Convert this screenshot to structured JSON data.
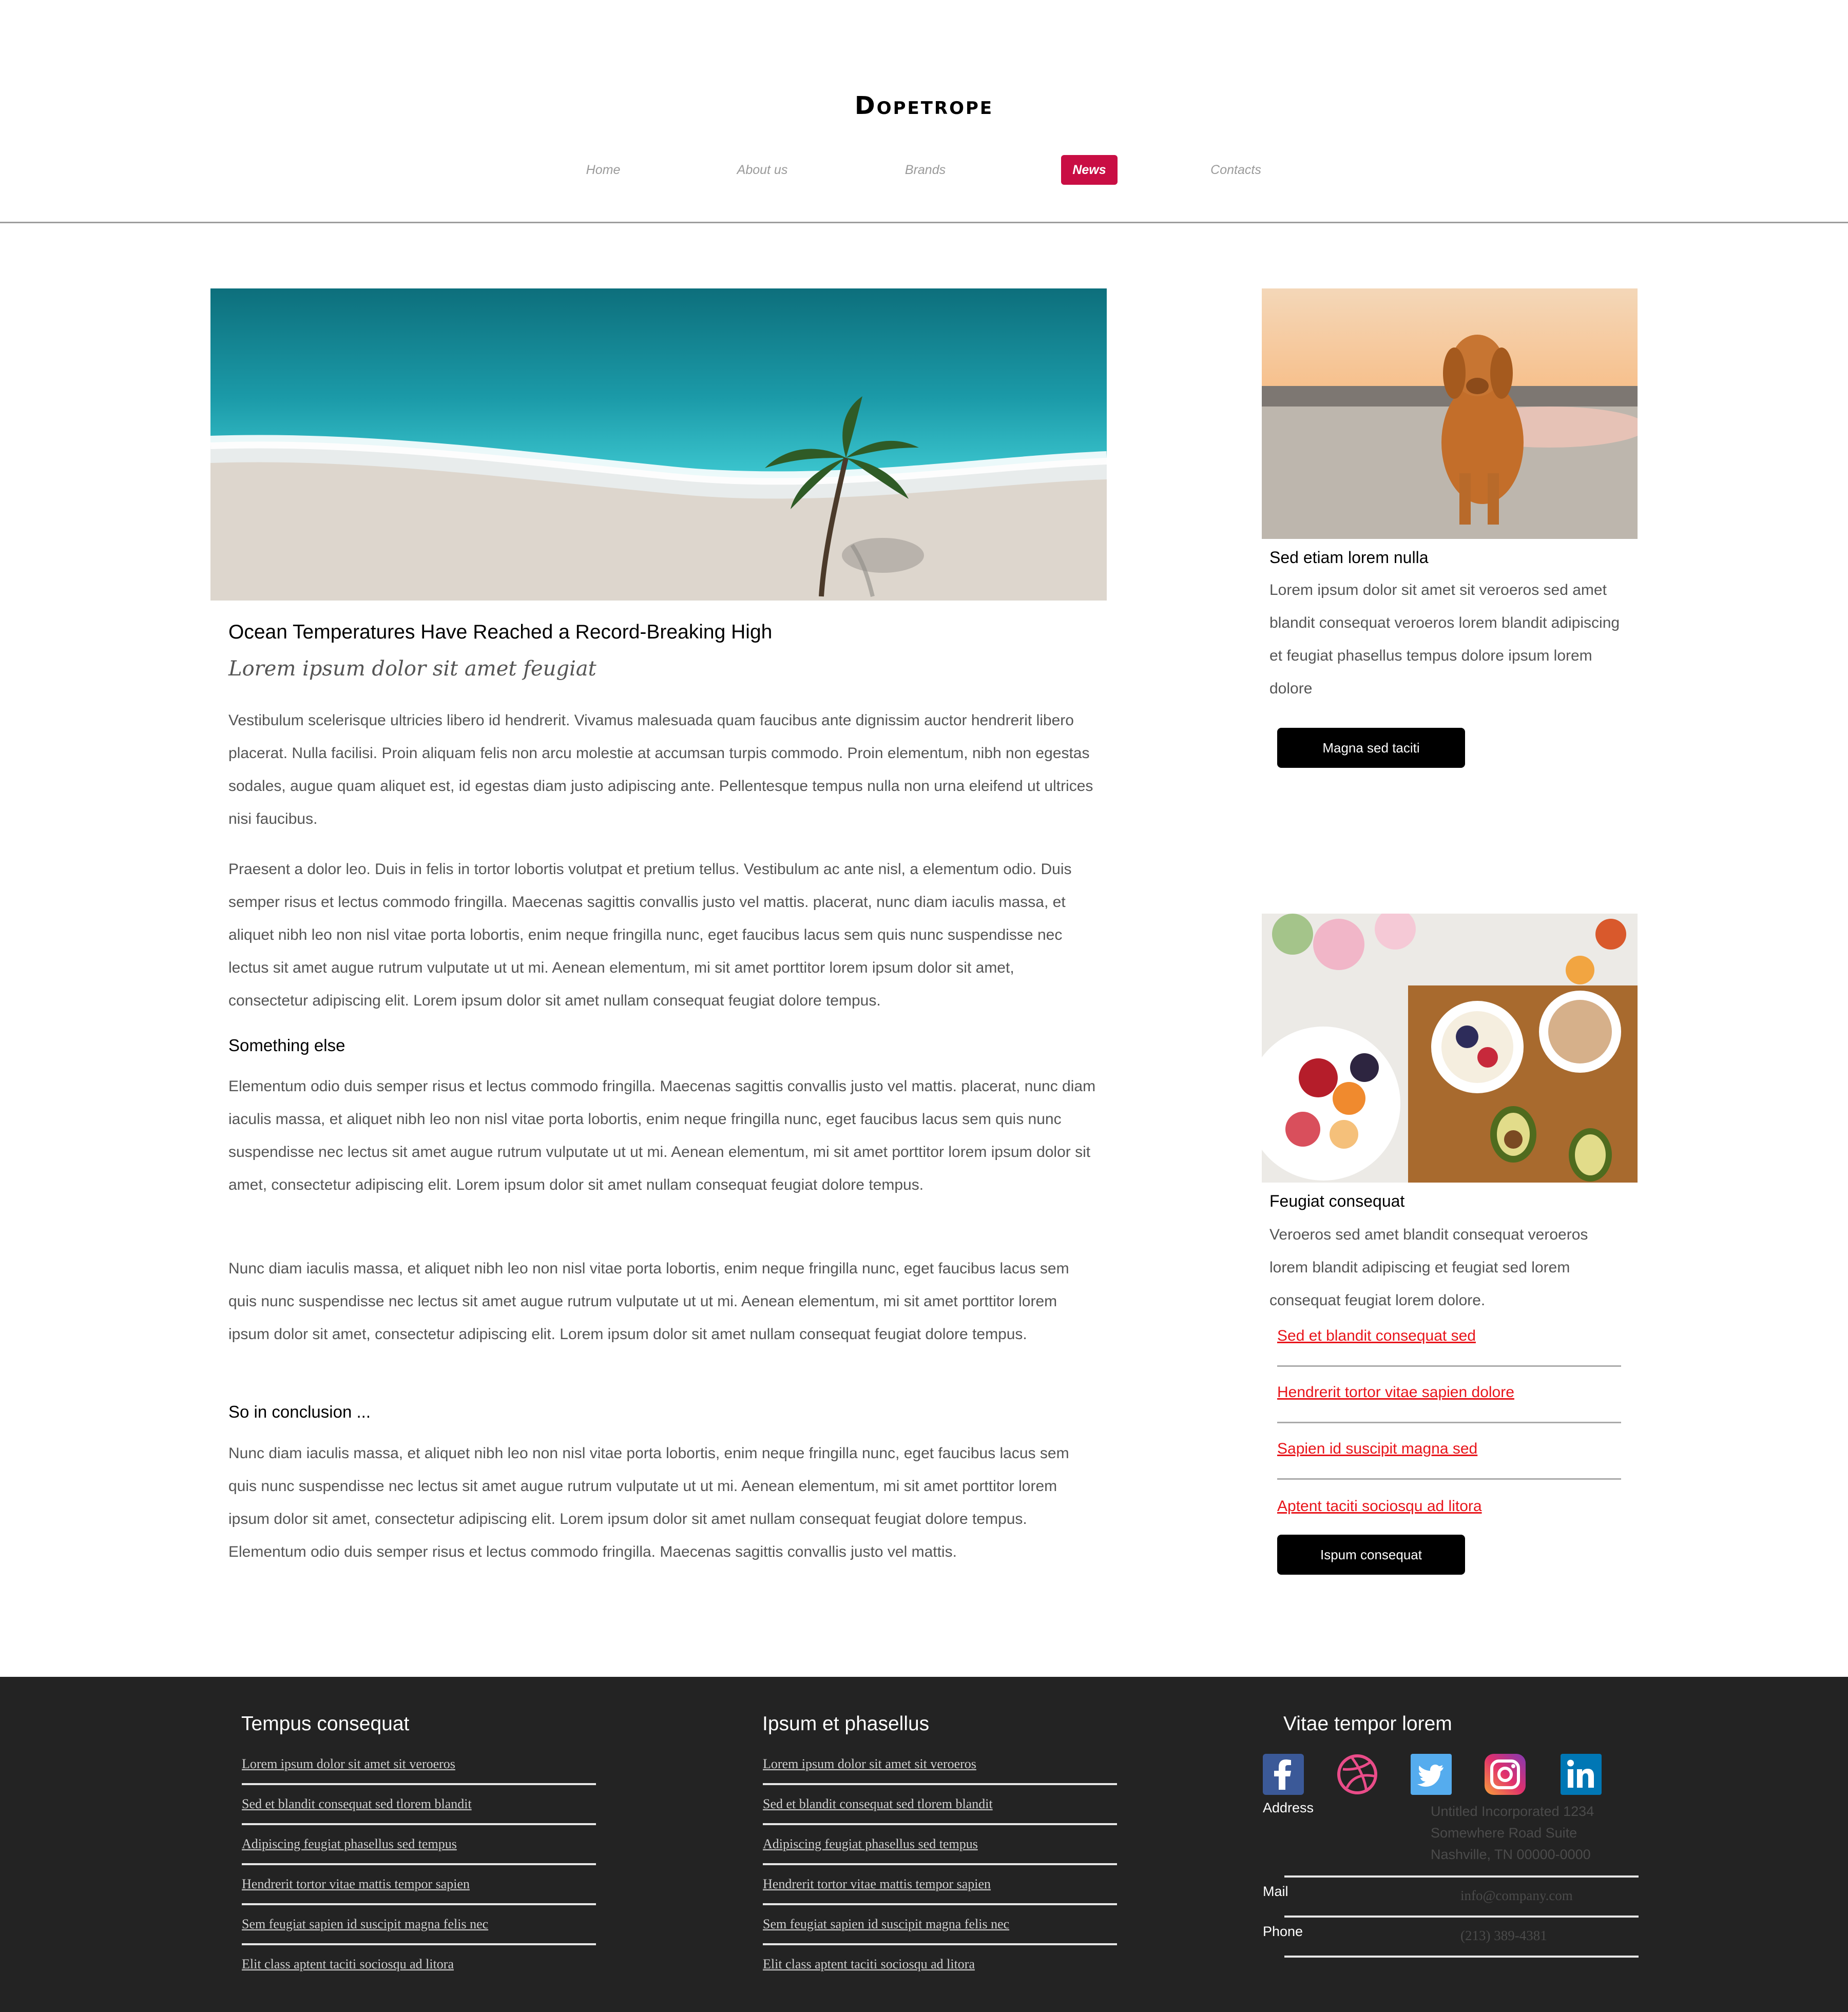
{
  "brand": {
    "logo": "Dopetrope"
  },
  "nav": {
    "items": [
      {
        "label": "Home"
      },
      {
        "label": "About us"
      },
      {
        "label": "Brands"
      },
      {
        "label": "News",
        "active": true
      },
      {
        "label": "Contacts"
      }
    ]
  },
  "article": {
    "title": "Ocean Temperatures Have Reached a Record-Breaking High",
    "subtitle": "Lorem ipsum dolor sit amet feugiat",
    "paragraphs": [
      "Vestibulum scelerisque ultricies libero id hendrerit. Vivamus malesuada quam faucibus ante dignissim auctor hendrerit libero placerat. Nulla facilisi. Proin aliquam felis non arcu molestie at accumsan turpis commodo. Proin elementum, nibh non egestas sodales, augue quam aliquet est, id egestas diam justo adipiscing ante. Pellentesque tempus nulla non urna eleifend ut ultrices nisi faucibus.",
      "Praesent a dolor leo. Duis in felis in tortor lobortis volutpat et pretium tellus. Vestibulum ac ante nisl, a elementum odio. Duis semper risus et lectus commodo fringilla. Maecenas sagittis convallis justo vel mattis. placerat, nunc diam iaculis massa, et aliquet nibh leo non nisl vitae porta lobortis, enim neque fringilla nunc, eget faucibus lacus sem quis nunc suspendisse nec lectus sit amet augue rutrum vulputate ut ut mi. Aenean elementum, mi sit amet porttitor lorem ipsum dolor sit amet, consectetur adipiscing elit. Lorem ipsum dolor sit amet nullam consequat feugiat dolore tempus.",
      "Elementum odio duis semper risus et lectus commodo fringilla. Maecenas sagittis convallis justo vel mattis. placerat, nunc diam iaculis massa, et aliquet nibh leo non nisl vitae porta lobortis, enim neque fringilla nunc, eget faucibus lacus sem quis nunc suspendisse nec lectus sit amet augue rutrum vulputate ut ut mi. Aenean elementum, mi sit amet porttitor lorem ipsum dolor sit amet, consectetur adipiscing elit. Lorem ipsum dolor sit amet nullam consequat feugiat dolore tempus.",
      "Nunc diam iaculis massa, et aliquet nibh leo non nisl vitae porta lobortis, enim neque fringilla nunc, eget faucibus lacus sem quis nunc suspendisse nec lectus sit amet augue rutrum vulputate ut ut mi. Aenean elementum, mi sit amet porttitor lorem ipsum dolor sit amet, consectetur adipiscing elit. Lorem ipsum dolor sit amet nullam consequat feugiat dolore tempus.",
      "Nunc diam iaculis massa, et aliquet nibh leo non nisl vitae porta lobortis, enim neque fringilla nunc, eget faucibus lacus sem quis nunc suspendisse nec lectus sit amet augue rutrum vulputate ut ut mi. Aenean elementum, mi sit amet porttitor lorem ipsum dolor sit amet, consectetur adipiscing elit. Lorem ipsum dolor sit amet nullam consequat feugiat dolore tempus. Elementum odio duis semper risus et lectus commodo fringilla. Maecenas sagittis convallis justo vel mattis."
    ],
    "heading_something": "Something else",
    "heading_conclusion": "So in conclusion ..."
  },
  "sidebar": {
    "card1": {
      "title": "Sed etiam lorem nulla",
      "text": "Lorem ipsum dolor sit amet sit veroeros sed amet blandit consequat veroeros lorem blandit adipiscing et feugiat phasellus tempus dolore ipsum lorem dolore",
      "button": "Magna sed taciti"
    },
    "card2": {
      "title": "Feugiat consequat",
      "text": "Veroeros sed amet blandit consequat veroeros lorem blandit adipiscing et feugiat sed lorem consequat feugiat lorem dolore.",
      "links": [
        "Sed et blandit consequat sed",
        "Hendrerit tortor vitae sapien dolore",
        "Sapien id suscipit magna sed",
        "Aptent taciti sociosqu ad litora"
      ],
      "button": "Ispum consequat"
    }
  },
  "footer": {
    "col1": {
      "title": "Tempus consequat",
      "links": [
        "Lorem ipsum dolor sit amet sit veroeros",
        "Sed et blandit consequat sed tlorem blandit",
        "Adipiscing feugiat phasellus sed tempus",
        "Hendrerit tortor vitae mattis tempor sapien",
        "Sem feugiat sapien id suscipit magna felis nec",
        "Elit class aptent taciti sociosqu ad litora"
      ]
    },
    "col2": {
      "title": "Ipsum et phasellus",
      "links": [
        "Lorem ipsum dolor sit amet sit veroeros",
        "Sed et blandit consequat sed tlorem blandit",
        "Adipiscing feugiat phasellus sed tempus",
        "Hendrerit tortor vitae mattis tempor sapien",
        "Sem feugiat sapien id suscipit magna felis nec",
        "Elit class aptent taciti sociosqu ad litora"
      ]
    },
    "col3": {
      "title": "Vitae tempor lorem",
      "social": [
        "facebook-icon",
        "dribbble-icon",
        "twitter-icon",
        "instagram-icon",
        "linkedin-icon"
      ],
      "address_label": "Address",
      "address_lines": [
        "Untitled Incorporated 1234",
        "Somewhere Road Suite",
        "Nashville, TN 00000-0000"
      ],
      "mail_label": "Mail",
      "mail_value": "info@company.com",
      "phone_label": "Phone",
      "phone_value": "(213) 389-4381"
    }
  },
  "colors": {
    "accent": "#c90e44",
    "link": "#e8141a",
    "footer_bg": "#232323"
  }
}
